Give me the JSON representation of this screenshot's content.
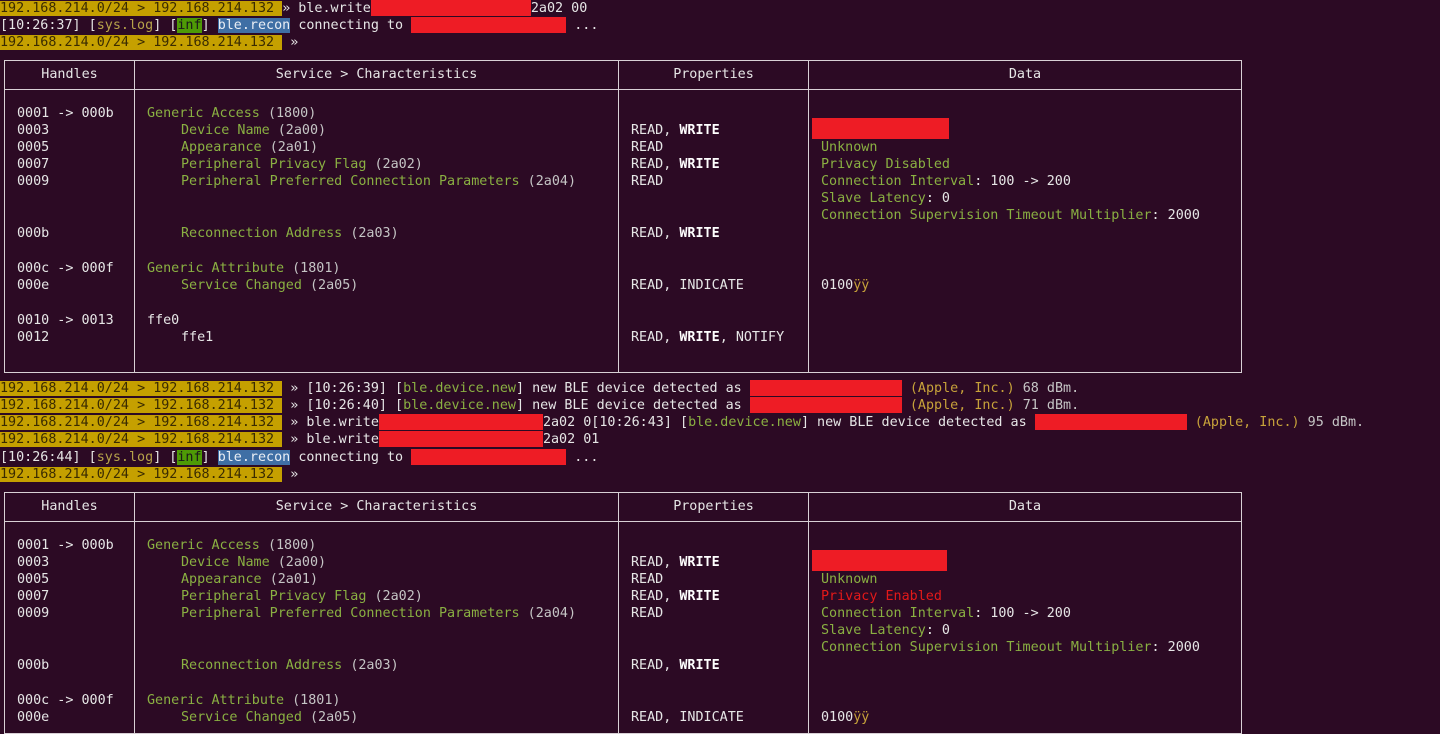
{
  "terminal": {
    "prompt_src": "192.168.214.0/24",
    "prompt_dst": "192.168.214.132",
    "prompt_sep": ">",
    "prompt_end": "»",
    "lines_top": {
      "cmd1_prefix": "» ble.write",
      "cmd1_suffix": "2a02 00",
      "log1_time": "[10:26:37]",
      "log_sys": "sys.log",
      "log_inf": "inf",
      "log_recon": "ble.recon",
      "log_connecting": "connecting to",
      "log_ellipsis": "..."
    },
    "lines_mid": {
      "ev1": "» [10:26:39] [",
      "ev2": "» [10:26:40] [",
      "ev_tag": "ble.device.new",
      "ev_text": "] new BLE device detected as",
      "vendor": "(Apple, Inc.)",
      "rssi1": "68 dBm.",
      "rssi2": "71 dBm.",
      "rssi3": "95 dBm.",
      "cmd2_prefix": "» ble.write",
      "cmd2_suffix": "2a02 0[10:26:43] [",
      "cmd3_suffix": "2a02 01",
      "log2_time": "[10:26:44]"
    }
  },
  "table_headers": {
    "handles": "Handles",
    "service": "Service > Characteristics",
    "properties": "Properties",
    "data": "Data"
  },
  "table_rows": {
    "h_0001": "0001 -> 000b",
    "h_0003": "0003",
    "h_0005": "0005",
    "h_0007": "0007",
    "h_0009": "0009",
    "h_000b": "000b",
    "h_000c": "000c -> 000f",
    "h_000e": "000e",
    "h_0010": "0010 -> 0013",
    "h_0012": "0012",
    "s_generic_access": "Generic Access",
    "s_1800": "(1800)",
    "s_device_name": "Device Name",
    "s_2a00": "(2a00)",
    "s_appearance": "Appearance",
    "s_2a01": "(2a01)",
    "s_privacy_flag": "Peripheral Privacy Flag",
    "s_2a02": "(2a02)",
    "s_pref_conn": "Peripheral Preferred Connection Parameters",
    "s_2a04": "(2a04)",
    "s_reconn": "Reconnection Address",
    "s_2a03": "(2a03)",
    "s_generic_attr": "Generic Attribute",
    "s_1801": "(1801)",
    "s_service_changed": "Service Changed",
    "s_2a05": "(2a05)",
    "s_ffe0": "ffe0",
    "s_ffe1": "ffe1",
    "p_read": "READ",
    "p_write": "WRITE",
    "p_notify": "NOTIFY",
    "p_indicate": "INDICATE",
    "p_comma": ",",
    "d_unknown": "Unknown",
    "d_priv_disabled": "Privacy Disabled",
    "d_priv_enabled": "Privacy Enabled",
    "d_conn_interval": "Connection Interval",
    "d_conn_interval_val": ": 100 -> 200",
    "d_slave_latency": "Slave Latency",
    "d_slave_latency_val": ": 0",
    "d_timeout": "Connection Supervision Timeout Multiplier",
    "d_timeout_val": ": 2000",
    "d_sc_val1": "0100",
    "d_sc_val2": "ÿÿ"
  },
  "colors": {
    "background": "#2c0a24",
    "prompt_bg": "#c5a000",
    "redaction": "#ee1c25",
    "green_text": "#8ab042",
    "inf_badge": "#4e9a06",
    "recon_badge": "#3f6fa5",
    "privacy_enabled": "#e41919"
  }
}
